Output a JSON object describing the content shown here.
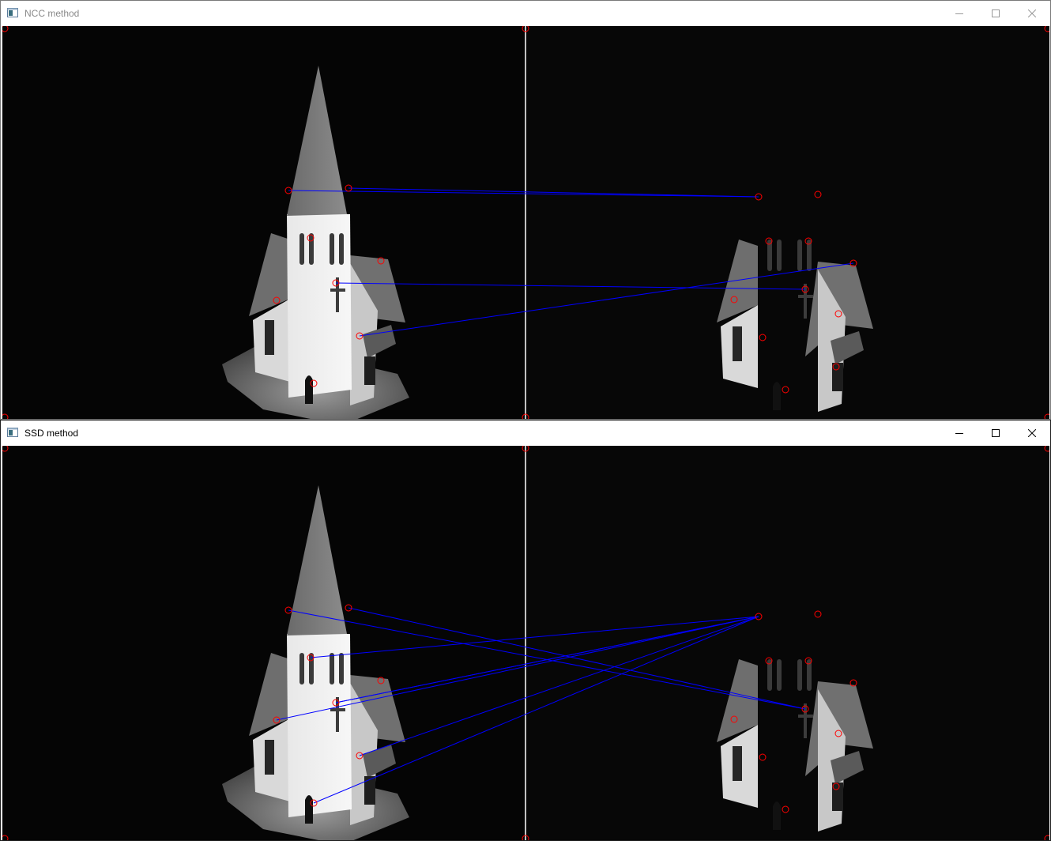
{
  "windows": [
    {
      "title": "NCC method",
      "controls": {
        "minimize": "minimize",
        "maximize": "maximize",
        "close": "close"
      }
    },
    {
      "title": "SSD method",
      "controls": {
        "minimize": "minimize",
        "maximize": "maximize",
        "close": "close"
      }
    }
  ],
  "colors": {
    "match_line": "#0000ff",
    "keypoint": "#ff0000",
    "divider": "#ffffff",
    "image_background": "#000000"
  },
  "icons": [
    "app-window-icon",
    "minimize-icon",
    "maximize-icon",
    "close-icon"
  ]
}
